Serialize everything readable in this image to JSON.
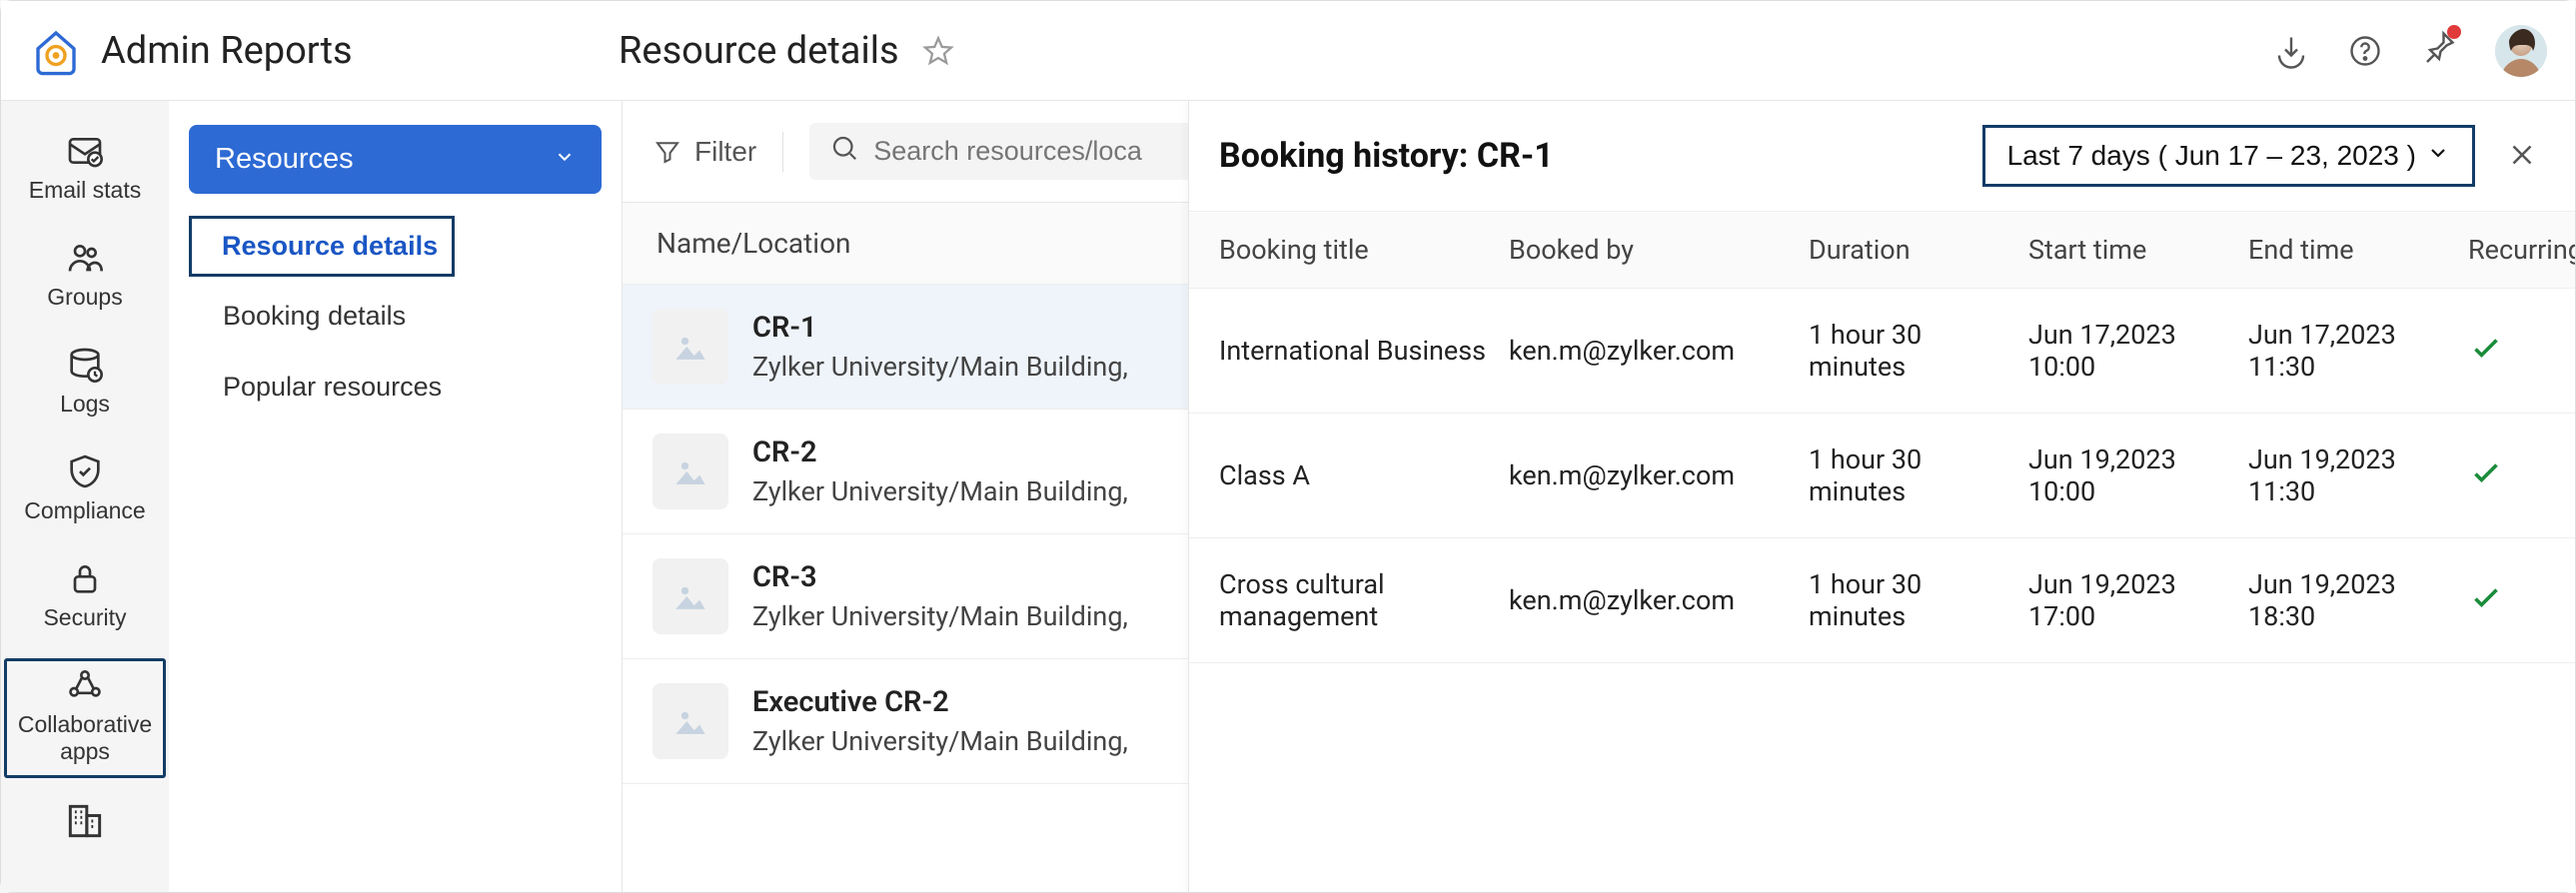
{
  "header": {
    "app_title": "Admin Reports",
    "page_title": "Resource details"
  },
  "rail": {
    "items": [
      {
        "label": "Email stats"
      },
      {
        "label": "Groups"
      },
      {
        "label": "Logs"
      },
      {
        "label": "Compliance"
      },
      {
        "label": "Security"
      },
      {
        "label": "Collaborative apps"
      }
    ]
  },
  "sidebar": {
    "accordion_label": "Resources",
    "items": [
      {
        "label": "Resource details"
      },
      {
        "label": "Booking details"
      },
      {
        "label": "Popular resources"
      }
    ]
  },
  "toolbar": {
    "filter_label": "Filter",
    "search_placeholder": "Search resources/loca"
  },
  "list": {
    "header": "Name/Location",
    "rows": [
      {
        "name": "CR-1",
        "location": "Zylker University/Main Building,"
      },
      {
        "name": "CR-2",
        "location": "Zylker University/Main Building,"
      },
      {
        "name": "CR-3",
        "location": "Zylker University/Main Building,"
      },
      {
        "name": "Executive CR-2",
        "location": "Zylker University/Main Building,"
      }
    ]
  },
  "panel": {
    "title": "Booking history: CR-1",
    "date_range": "Last 7 days ( Jun 17 – 23, 2023 )",
    "columns": {
      "title": "Booking title",
      "booked_by": "Booked by",
      "duration": "Duration",
      "start": "Start time",
      "end": "End time",
      "recurring": "Recurring"
    },
    "rows": [
      {
        "title": "International Business",
        "booked_by": "ken.m@zylker.com",
        "duration": "1 hour 30 minutes",
        "start": "Jun 17,2023 10:00",
        "end": "Jun 17,2023 11:30"
      },
      {
        "title": "Class A",
        "booked_by": "ken.m@zylker.com",
        "duration": "1 hour 30 minutes",
        "start": "Jun 19,2023 10:00",
        "end": "Jun 19,2023 11:30"
      },
      {
        "title": "Cross cultural management",
        "booked_by": "ken.m@zylker.com",
        "duration": "1 hour 30 minutes",
        "start": "Jun 19,2023 17:00",
        "end": "Jun 19,2023 18:30"
      }
    ]
  }
}
